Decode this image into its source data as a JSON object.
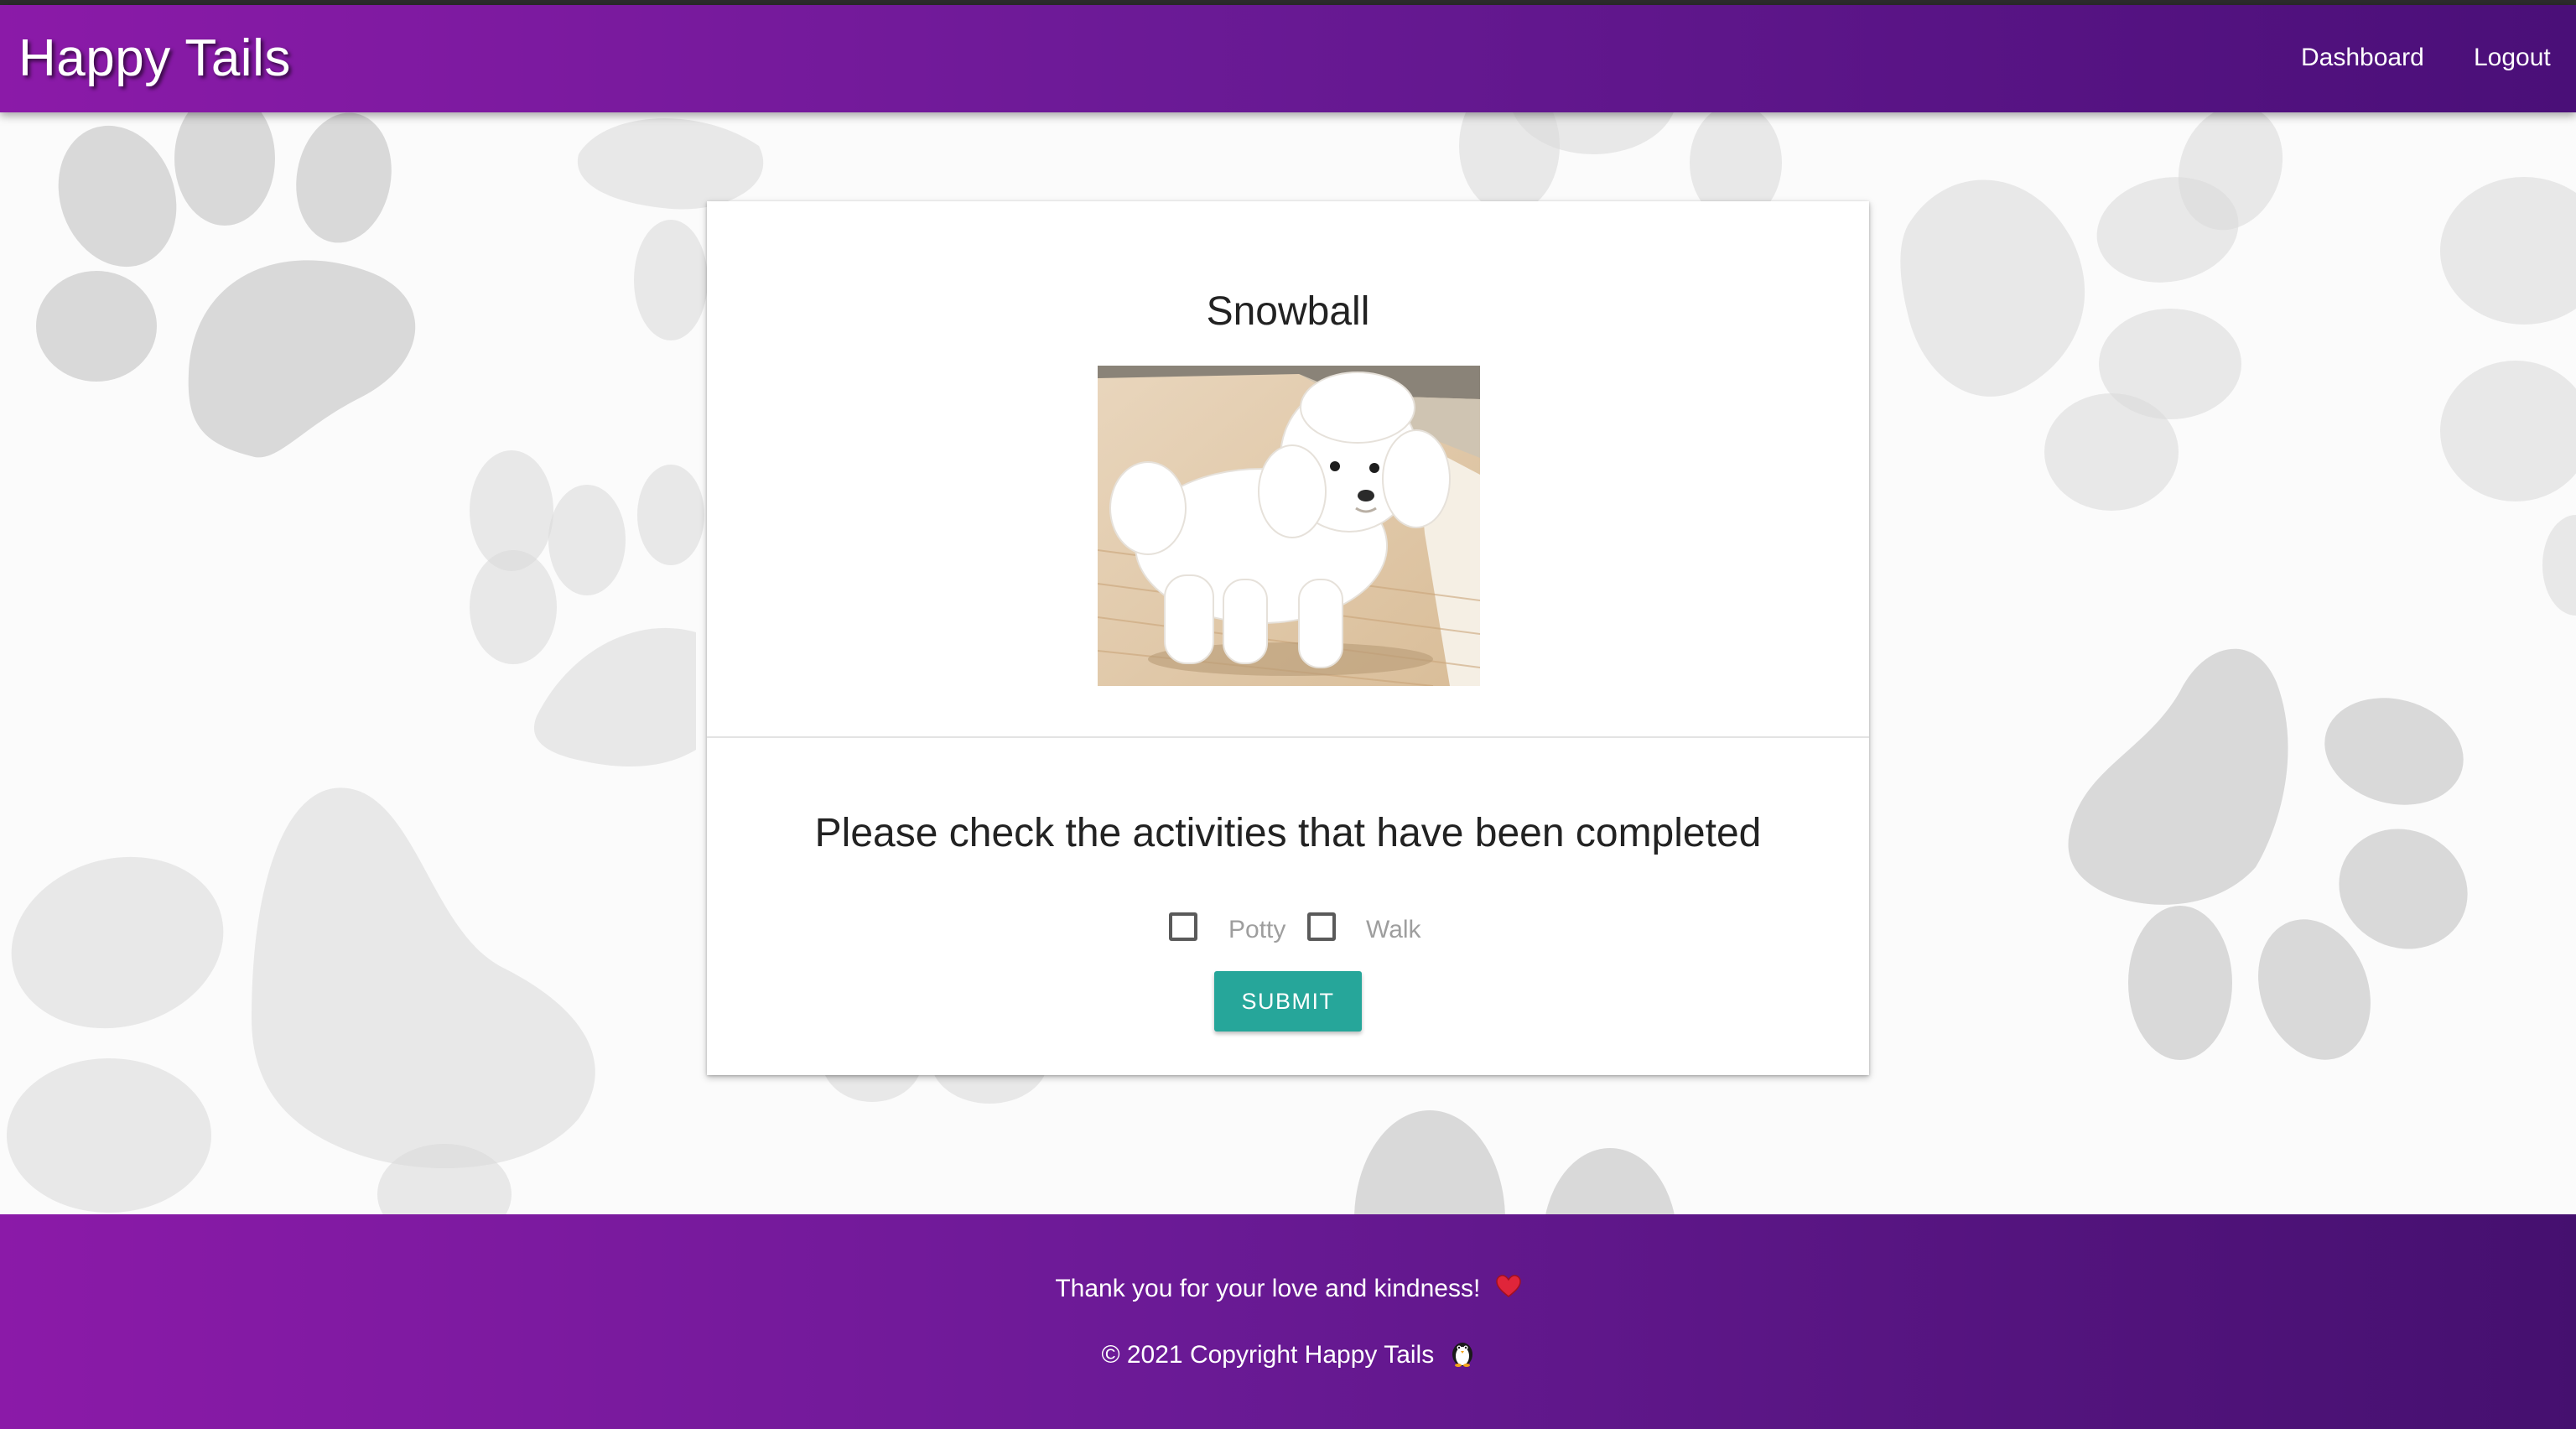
{
  "app": {
    "brand": "Happy Tails"
  },
  "nav": {
    "links": [
      {
        "label": "Dashboard"
      },
      {
        "label": "Logout"
      }
    ]
  },
  "pet": {
    "name": "Snowball",
    "photo_icon": "white-poodle-photo"
  },
  "activities": {
    "prompt": "Please check the activities that have been completed",
    "options": [
      {
        "label": "Potty",
        "checked": false
      },
      {
        "label": "Walk",
        "checked": false
      }
    ],
    "submit_label": "SUBMIT"
  },
  "footer": {
    "thanks": "Thank you for your love and kindness!",
    "copyright": "© 2021 Copyright Happy Tails",
    "icons": [
      "heart-icon",
      "penguin-icon"
    ]
  },
  "colors": {
    "header_gradient_start": "#8b1aa8",
    "header_gradient_end": "#4a0f78",
    "submit_button": "#26a69a",
    "paw_gray": "#d9d9d9"
  }
}
